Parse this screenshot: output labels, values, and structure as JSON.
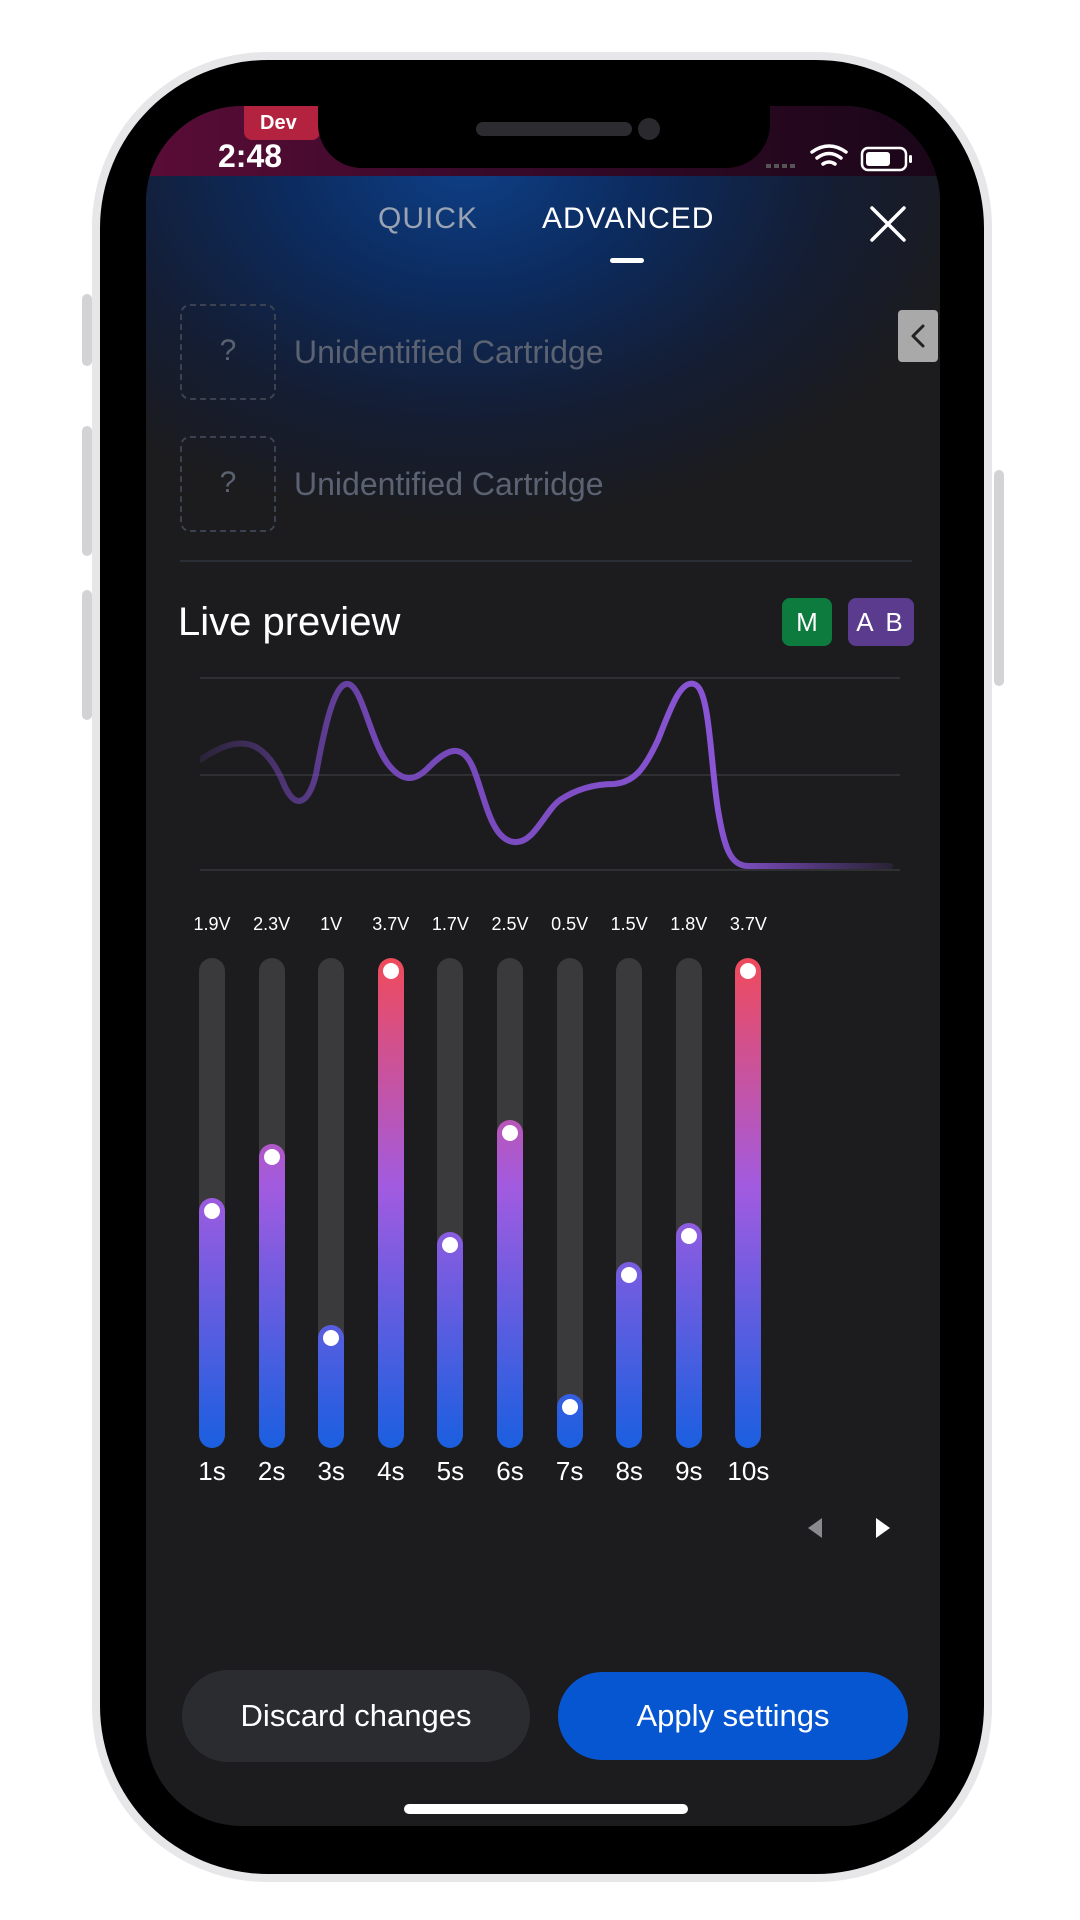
{
  "status_bar": {
    "time": "2:48",
    "dev_label": "Dev"
  },
  "tabs": [
    {
      "label": "QUICK",
      "active": false
    },
    {
      "label": "ADVANCED",
      "active": true
    }
  ],
  "cartridges": [
    {
      "label": "Unidentified Cartridge",
      "placeholder": "?"
    },
    {
      "label": "Unidentified Cartridge",
      "placeholder": "?"
    }
  ],
  "preview": {
    "title": "Live preview",
    "badge_m": "M",
    "badge_ab": "A B"
  },
  "sliders": [
    {
      "time": "1s",
      "voltage": "1.9V",
      "level": 0.51
    },
    {
      "time": "2s",
      "voltage": "2.3V",
      "level": 0.62
    },
    {
      "time": "3s",
      "voltage": "1V",
      "level": 0.25
    },
    {
      "time": "4s",
      "voltage": "3.7V",
      "level": 1.0
    },
    {
      "time": "5s",
      "voltage": "1.7V",
      "level": 0.44
    },
    {
      "time": "6s",
      "voltage": "2.5V",
      "level": 0.67
    },
    {
      "time": "7s",
      "voltage": "0.5V",
      "level": 0.11
    },
    {
      "time": "8s",
      "voltage": "1.5V",
      "level": 0.38
    },
    {
      "time": "9s",
      "voltage": "1.8V",
      "level": 0.46
    },
    {
      "time": "10s",
      "voltage": "3.7V",
      "level": 1.0
    }
  ],
  "buttons": {
    "discard": "Discard changes",
    "apply": "Apply settings"
  },
  "colors": {
    "accent": "#0756d1",
    "badge_m": "#0d7a3e",
    "badge_ab": "#5b3b8e",
    "slider_top": "#f04a5a",
    "slider_mid": "#a15be0",
    "slider_bottom": "#1a5fe0"
  }
}
